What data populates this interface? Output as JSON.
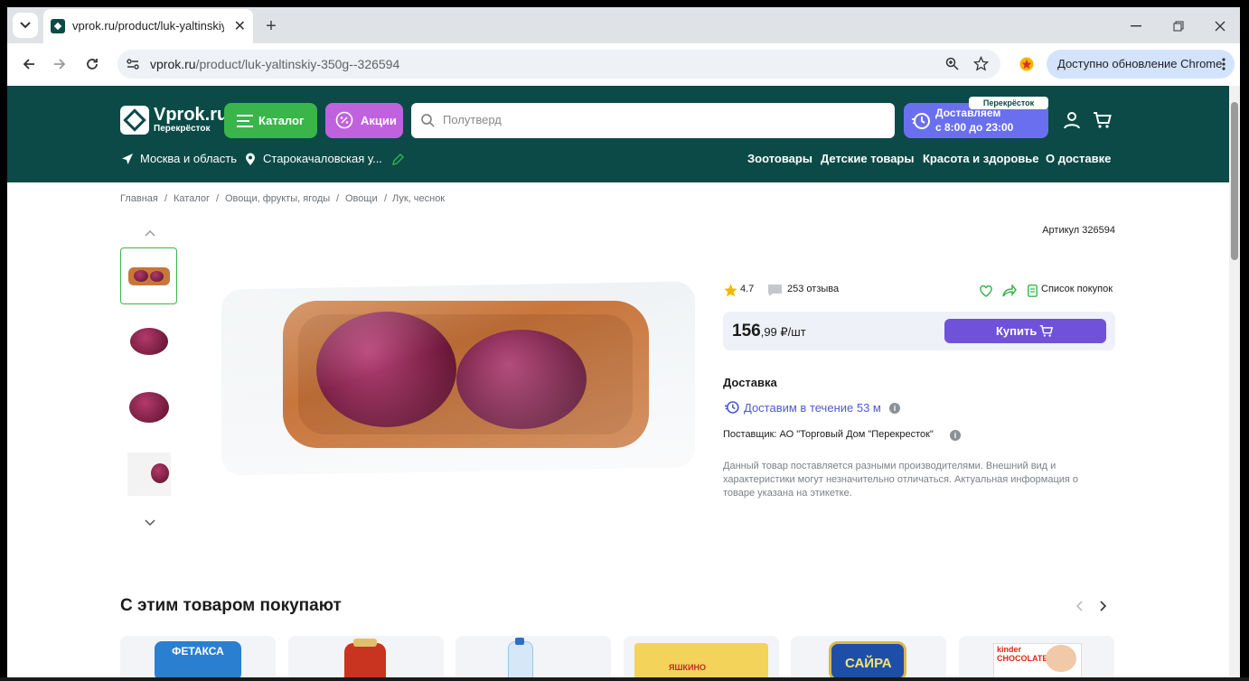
{
  "browser": {
    "tab_title": "vprok.ru/product/luk-yaltinskiy-",
    "url_host": "vprok.ru",
    "url_path": "/product/luk-yaltinskiy-350g--326594",
    "update_label": "Доступно обновление Chrome"
  },
  "header": {
    "logo_name": "Vprok.ru",
    "logo_sub": "Перекрёсток",
    "catalog_label": "Каталог",
    "promo_label": "Акции",
    "search_placeholder": "Полутверд",
    "delivery_line1": "Доставляем",
    "delivery_line2": "с 8:00 до 23:00",
    "perek_badge": "Перекрёсток",
    "region": "Москва и область",
    "address": "Старокачаловская у...",
    "nav": [
      "Зоотовары",
      "Детские товары",
      "Красота и здоровье",
      "О доставке"
    ]
  },
  "breadcrumb": [
    "Главная",
    "Каталог",
    "Овощи, фрукты, ягоды",
    "Овощи",
    "Лук, чеснок"
  ],
  "product": {
    "sku": "Артикул 326594",
    "rating": "4.7",
    "reviews": "253 отзыва",
    "shopping_list": "Список покупок",
    "price_main": "156",
    "price_rest": ",99 ₽/шт",
    "buy_label": "Купить",
    "delivery_heading": "Доставка",
    "delivery_time": "Доставим в течение 53 м",
    "supplier": "Поставщик: АО \"Торговый Дом \"Перекресток\"",
    "disclaimer": "Данный товар поставляется разными производителями. Внешний вид и характеристики могут незначительно отличаться. Актуальная информация о товаре указана на этикетке."
  },
  "related": {
    "title": "С этим товаром покупают",
    "card_labels": [
      "ФЕТАКСА",
      "",
      "",
      "ЯШКИНО",
      "САЙРА",
      "kinder CHOCOLATE"
    ]
  },
  "colors": {
    "header_bg": "#0b4a47",
    "catalog_green": "#3ab54a",
    "promo_purple": "#c062de",
    "delivery_blue": "#6a6ff0",
    "buy_purple": "#6f52d9"
  }
}
